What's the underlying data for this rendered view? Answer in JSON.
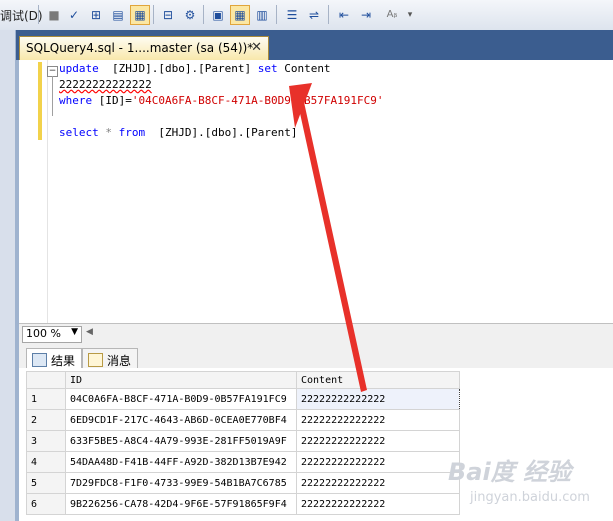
{
  "toolbar": {
    "debug_menu": "调试(D)",
    "icons": [
      "stop-icon",
      "check-icon",
      "parse-icon",
      "display-plan-icon",
      "results-to-grid-icon",
      "include-plan-icon",
      "query-options-icon",
      "intellisense-icon",
      "results-to-text-icon",
      "indent-icon",
      "comment-icon",
      "uncomment-icon",
      "decrease-indent-icon",
      "increase-indent-icon",
      "specify-values-icon",
      "overflow-icon"
    ]
  },
  "tab": {
    "title": "SQLQuery4.sql - 1....master (sa (54))*",
    "close": "✕"
  },
  "editor": {
    "lines": [
      {
        "parts": [
          {
            "t": "update",
            "c": "kw"
          },
          {
            "t": "  [ZHJD].[dbo].[Parent] ",
            "c": "tx"
          },
          {
            "t": "set",
            "c": "kw"
          },
          {
            "t": " Content",
            "c": "tx"
          }
        ]
      },
      {
        "parts": [
          {
            "t": "22222222222222",
            "c": "tx"
          }
        ]
      },
      {
        "parts": [
          {
            "t": "where",
            "c": "kw"
          },
          {
            "t": " [ID]=",
            "c": "tx"
          },
          {
            "t": "'04C0A6FA-B8CF-471A-B0D9-0B57FA191FC9'",
            "c": "str"
          }
        ]
      },
      {
        "parts": []
      },
      {
        "parts": [
          {
            "t": "select",
            "c": "kw"
          },
          {
            "t": " * ",
            "c": "gr"
          },
          {
            "t": "from",
            "c": "kw"
          },
          {
            "t": "  [ZHJD].[dbo].[Parent]",
            "c": "tx"
          }
        ]
      }
    ]
  },
  "zoom": {
    "value": "100 %"
  },
  "results": {
    "tabs": [
      {
        "label": "结果",
        "icon": "grid-results-icon"
      },
      {
        "label": "消息",
        "icon": "messages-icon"
      }
    ],
    "columns": [
      "",
      "ID",
      "Content"
    ],
    "rows": [
      {
        "n": "1",
        "id": "04C0A6FA-B8CF-471A-B0D9-0B57FA191FC9",
        "content": "22222222222222"
      },
      {
        "n": "2",
        "id": "6ED9CD1F-217C-4643-AB6D-0CEA0E770BF4",
        "content": "22222222222222"
      },
      {
        "n": "3",
        "id": "633F5BE5-A8C4-4A79-993E-281FF5019A9F",
        "content": "22222222222222"
      },
      {
        "n": "4",
        "id": "54DAA48D-F41B-44FF-A92D-382D13B7E942",
        "content": "22222222222222"
      },
      {
        "n": "5",
        "id": "7D29FDC8-F1F0-4733-99E9-54B1BA7C6785",
        "content": "22222222222222"
      },
      {
        "n": "6",
        "id": "9B226256-CA78-42D4-9F6E-57F91865F9F4",
        "content": "22222222222222"
      }
    ]
  },
  "colors": {
    "keyword": "#0000ff",
    "string": "#d00000",
    "annotation_arrow": "#e8312a"
  },
  "watermark": {
    "brand": "Bai度 经验",
    "url": "jingyan.baidu.com"
  }
}
